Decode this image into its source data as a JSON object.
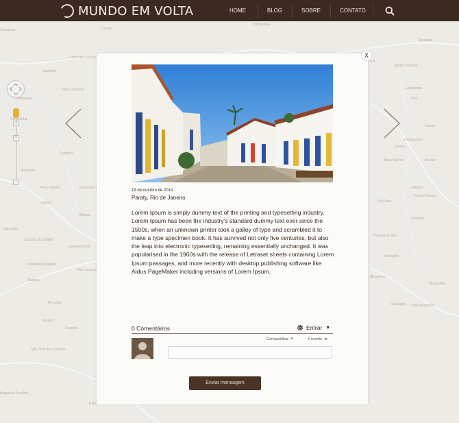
{
  "header": {
    "logo_text": "MUNDO EM VOLTA",
    "nav": [
      "HOME",
      "BLOG",
      "SOBRE",
      "CONTATO"
    ],
    "search_icon": "search-icon"
  },
  "map": {
    "towns": [
      "Lavras",
      "Varginha",
      "Três Corações",
      "Campos do Jordão",
      "Guaratinguetá",
      "Taubaté",
      "Pindamonhangaba",
      "Juiz de Fora",
      "Santos Dumont",
      "Barbacena",
      "Cataguases",
      "Ubá",
      "Muriaé",
      "Itajubá",
      "Pouso Alegre",
      "Paraíba do Sul",
      "Valença",
      "Petrópolis",
      "Teresópolis",
      "Nova Friburgo",
      "Resende",
      "Volta Redonda",
      "Campinas",
      "Jacareí",
      "São José dos Campos",
      "Três Rios",
      "Leopoldina",
      "Caxambu",
      "Lambari",
      "Campanha",
      "São Lourenço",
      "Cruzeiro",
      "Lorena",
      "Carmo de Cachoeira",
      "Barra Mansa",
      "Miracema",
      "Cordeiro",
      "Cantagalo",
      "Carmo",
      "Sapucaia",
      "Machado",
      "Alfenas",
      "Extrema",
      "Bragança Paulista",
      "Cambuquira",
      "Conceição do Rio Verde"
    ]
  },
  "post": {
    "date": "19 de outubro de 2014",
    "place": "Paraty, Rio de Janeiro",
    "body": "Lorem Ipsum is simply dummy text of the printing and typesetting industry. Lorem Ipsum has been the industry's standard dummy text ever since the 1500s, when an unknown printer took a galley of type and scrambled it to make a type specimen book. It has survived not only five centuries, but also the leap into electronic typesetting, remaining essentially unchanged. It was popularised in the 1960s with the release of Letraset sheets containing Lorem Ipsum passages, and more recently with desktop publishing software like Aldus PageMaker including versions of Lorem Ipsum."
  },
  "comments": {
    "count_label": "0 Comentários",
    "login_label": "Entrar",
    "share_label": "Compartilhar",
    "favorite_label": "Favorito",
    "input_placeholder": "",
    "send_label": "Enviar mensagem"
  },
  "modal": {
    "close_label": "X"
  },
  "colors": {
    "header": "#3c2a22",
    "button": "#4a3428",
    "map": "#ecebe6"
  }
}
